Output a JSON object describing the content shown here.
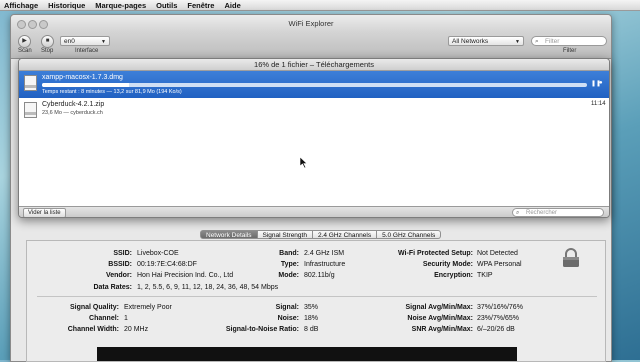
{
  "menubar": {
    "items": [
      "Affichage",
      "Historique",
      "Marque-pages",
      "Outils",
      "Fenêtre",
      "Aide"
    ]
  },
  "wifi_window": {
    "title": "WiFi Explorer",
    "toolbar": {
      "scan_label": "Scan",
      "stop_label": "Stop",
      "interface_value": "en0",
      "interface_label": "Interface",
      "networks_filter_value": "All Networks",
      "search_placeholder": "Filter",
      "filter_label": "Filter"
    }
  },
  "downloads_window": {
    "title": "16% de 1 fichier – Téléchargements",
    "items": [
      {
        "filename": "xampp-macosx-1.7.3.dmg",
        "status": "Temps restant : 8 minutes — 13,2 sur 81,9 Mo (194 Ko/s)",
        "progress": 0.16
      },
      {
        "filename": "Cyberduck-4.2.1.zip",
        "status": "23,6 Mo — cyberduck.ch",
        "time": "11:14"
      }
    ],
    "clear_button": "Vider la liste",
    "search_placeholder": "Rechercher"
  },
  "tabs": [
    "Network Details",
    "Signal Strength",
    "2.4 GHz Channels",
    "5.0 GHz Channels"
  ],
  "details": {
    "ssid_label": "SSID:",
    "ssid": "Livebox-COE",
    "bssid_label": "BSSID:",
    "bssid": "00:19:7E:C4:68:DF",
    "vendor_label": "Vendor:",
    "vendor": "Hon Hai Precision Ind. Co., Ltd",
    "rates_label": "Data Rates:",
    "rates": "1, 2, 5.5, 6, 9, 11, 12, 18, 24, 36, 48, 54 Mbps",
    "band_label": "Band:",
    "band": "2.4 GHz ISM",
    "type_label": "Type:",
    "type": "Infrastructure",
    "mode_label": "Mode:",
    "mode": "802.11b/g",
    "wps_label": "Wi-Fi Protected Setup:",
    "wps": "Not Detected",
    "security_label": "Security Mode:",
    "security": "WPA Personal",
    "encryption_label": "Encryption:",
    "encryption": "TKIP",
    "quality_label": "Signal Quality:",
    "quality": "Extremely Poor",
    "channel_label": "Channel:",
    "channel": "1",
    "width_label": "Channel Width:",
    "width": "20 MHz",
    "signal_label": "Signal:",
    "signal": "35%",
    "noise_label": "Noise:",
    "noise": "18%",
    "snr_label": "Signal-to-Noise Ratio:",
    "snr": "8 dB",
    "signal_avg_label": "Signal Avg/Min/Max:",
    "signal_avg": "37%/16%/76%",
    "noise_avg_label": "Noise Avg/Min/Max:",
    "noise_avg": "23%/7%/65%",
    "snr_avg_label": "SNR Avg/Min/Max:",
    "snr_avg": "6/–20/26 dB"
  },
  "colors": {
    "selection_blue": "#2f6fcf",
    "active_tab": "#7a7a7a"
  }
}
